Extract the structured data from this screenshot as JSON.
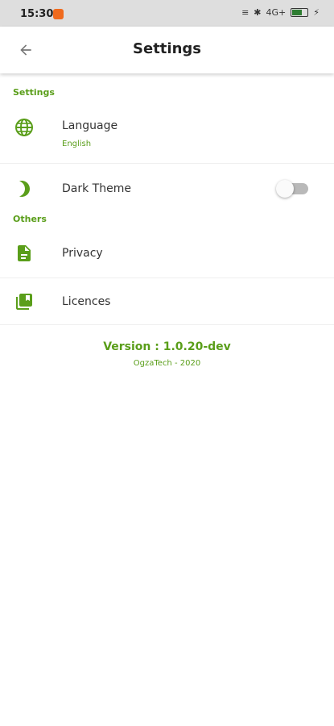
{
  "status_bar": {
    "time": "15:30",
    "network": "4G+"
  },
  "app_bar": {
    "title": "Settings",
    "back_icon": "arrow-back-icon"
  },
  "sections": {
    "settings": "Settings",
    "others": "Others"
  },
  "items": {
    "language": {
      "label": "Language",
      "value": "English",
      "icon": "globe-icon"
    },
    "dark_theme": {
      "label": "Dark Theme",
      "icon": "moon-icon",
      "enabled": false
    },
    "privacy": {
      "label": "Privacy",
      "icon": "document-icon"
    },
    "licences": {
      "label": "Licences",
      "icon": "library-icon"
    }
  },
  "version": "Version : 1.0.20-dev",
  "footer": "OgzaTech - 2020",
  "colors": {
    "accent": "#5a9e1a",
    "toggle_track": "#b9b9b9"
  }
}
